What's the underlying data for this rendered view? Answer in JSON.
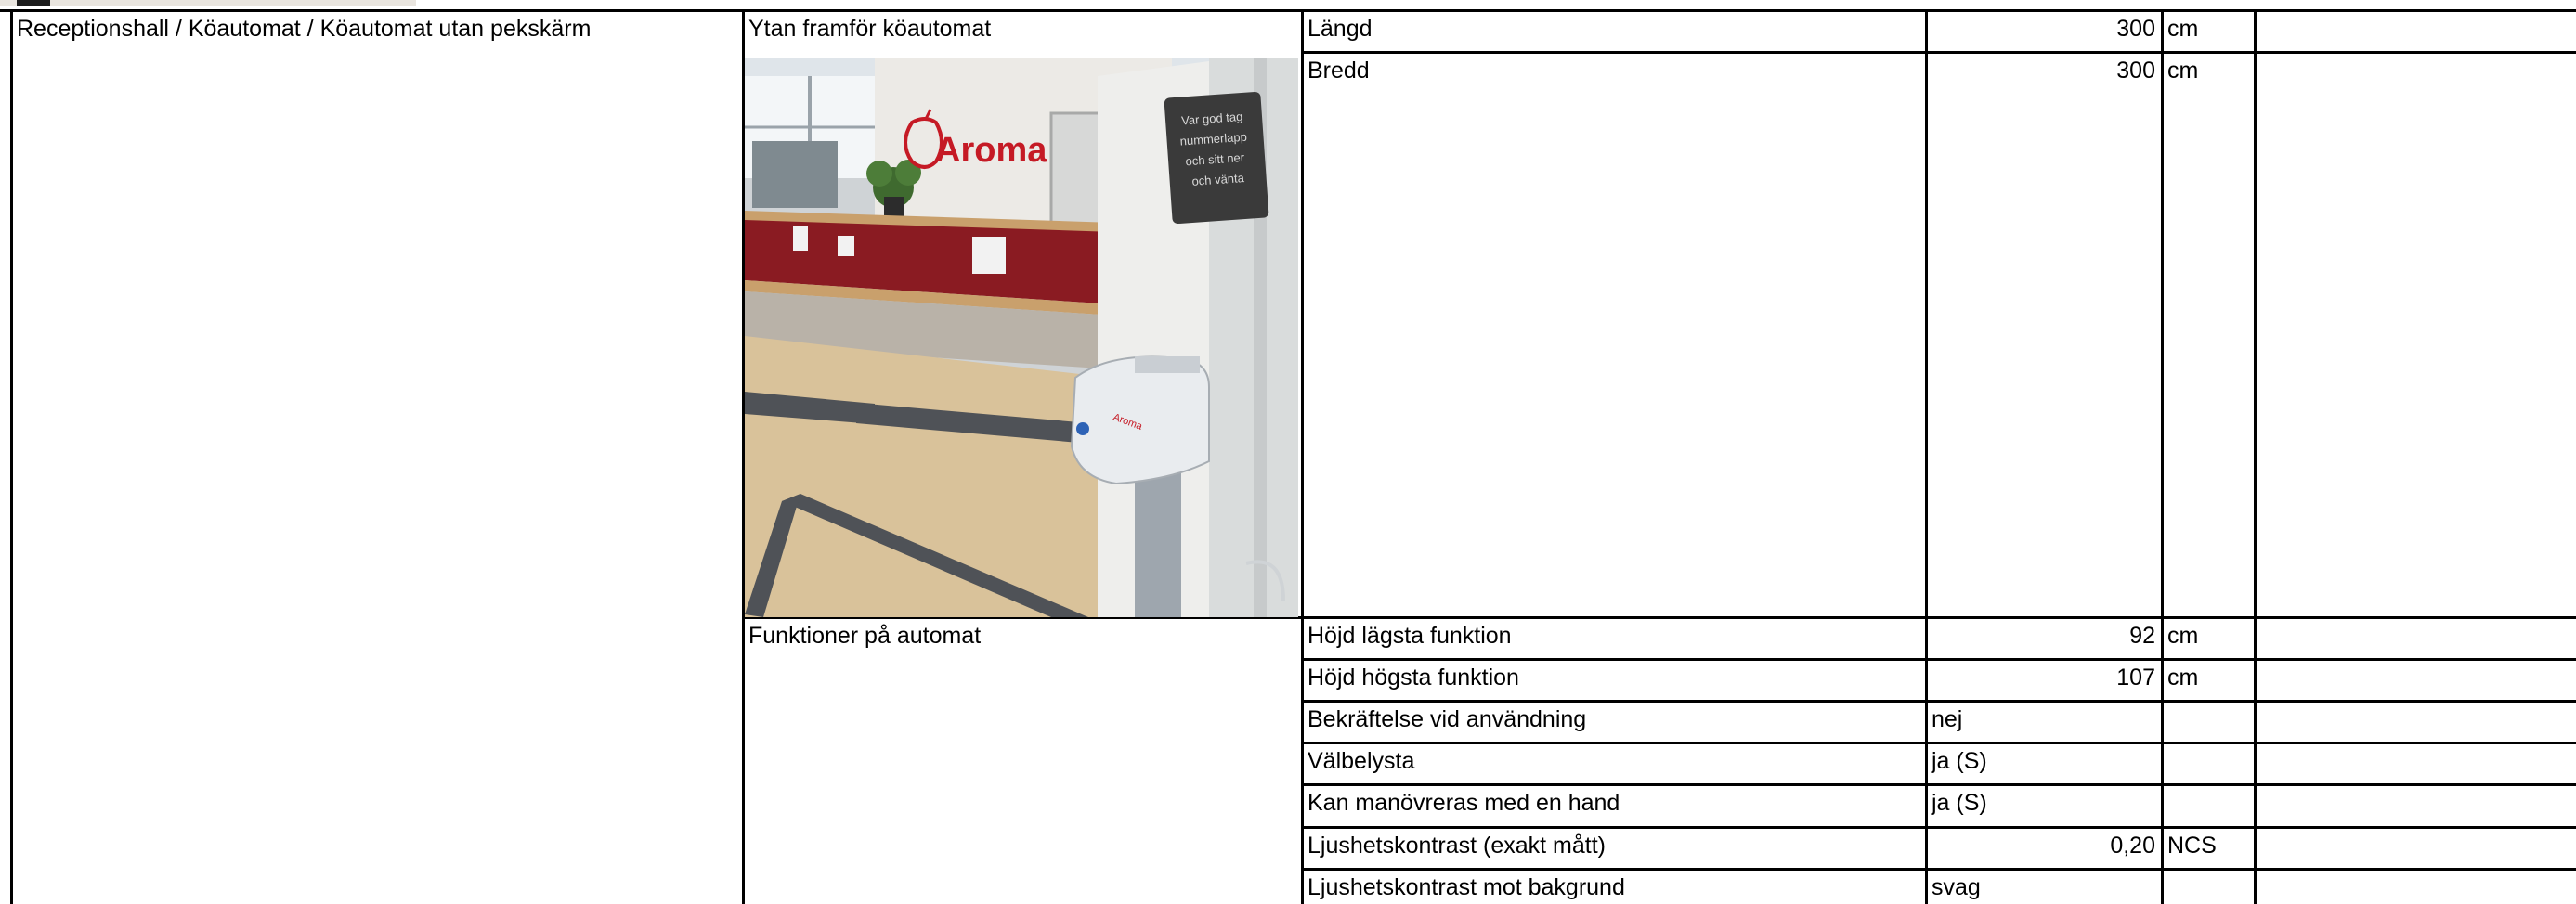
{
  "location": "Receptionshall / Köautomat / Köautomat utan pekskärm",
  "sections": [
    {
      "title": "Ytan framför köautomat",
      "rows": [
        {
          "label": "Längd",
          "value": "300",
          "unit": "cm"
        },
        {
          "label": "Bredd",
          "value": "300",
          "unit": "cm"
        }
      ]
    },
    {
      "title": "Funktioner på automat",
      "rows": [
        {
          "label": "Höjd lägsta funktion",
          "value": "92",
          "unit": "cm"
        },
        {
          "label": "Höjd högsta funktion",
          "value": "107",
          "unit": "cm"
        },
        {
          "label": "Bekräftelse vid användning",
          "value": "nej",
          "unit": ""
        },
        {
          "label": "Välbelysta",
          "value": "ja (S)",
          "unit": ""
        },
        {
          "label": "Kan manövreras med en hand",
          "value": "ja (S)",
          "unit": ""
        },
        {
          "label": "Ljushetskontrast (exakt mått)",
          "value": "0,20",
          "unit": "NCS"
        },
        {
          "label": "Ljushetskontrast mot bakgrund",
          "value": "svag",
          "unit": ""
        }
      ]
    }
  ],
  "photo": {
    "sign_lines": [
      "Var god tag",
      "nummerlapp",
      "och sitt ner",
      "och vänta"
    ],
    "brand": "Aroma",
    "colors": {
      "counter_red": "#8a1b22",
      "floor": "#d9c29a",
      "tactile_strip": "#4f5257"
    }
  }
}
